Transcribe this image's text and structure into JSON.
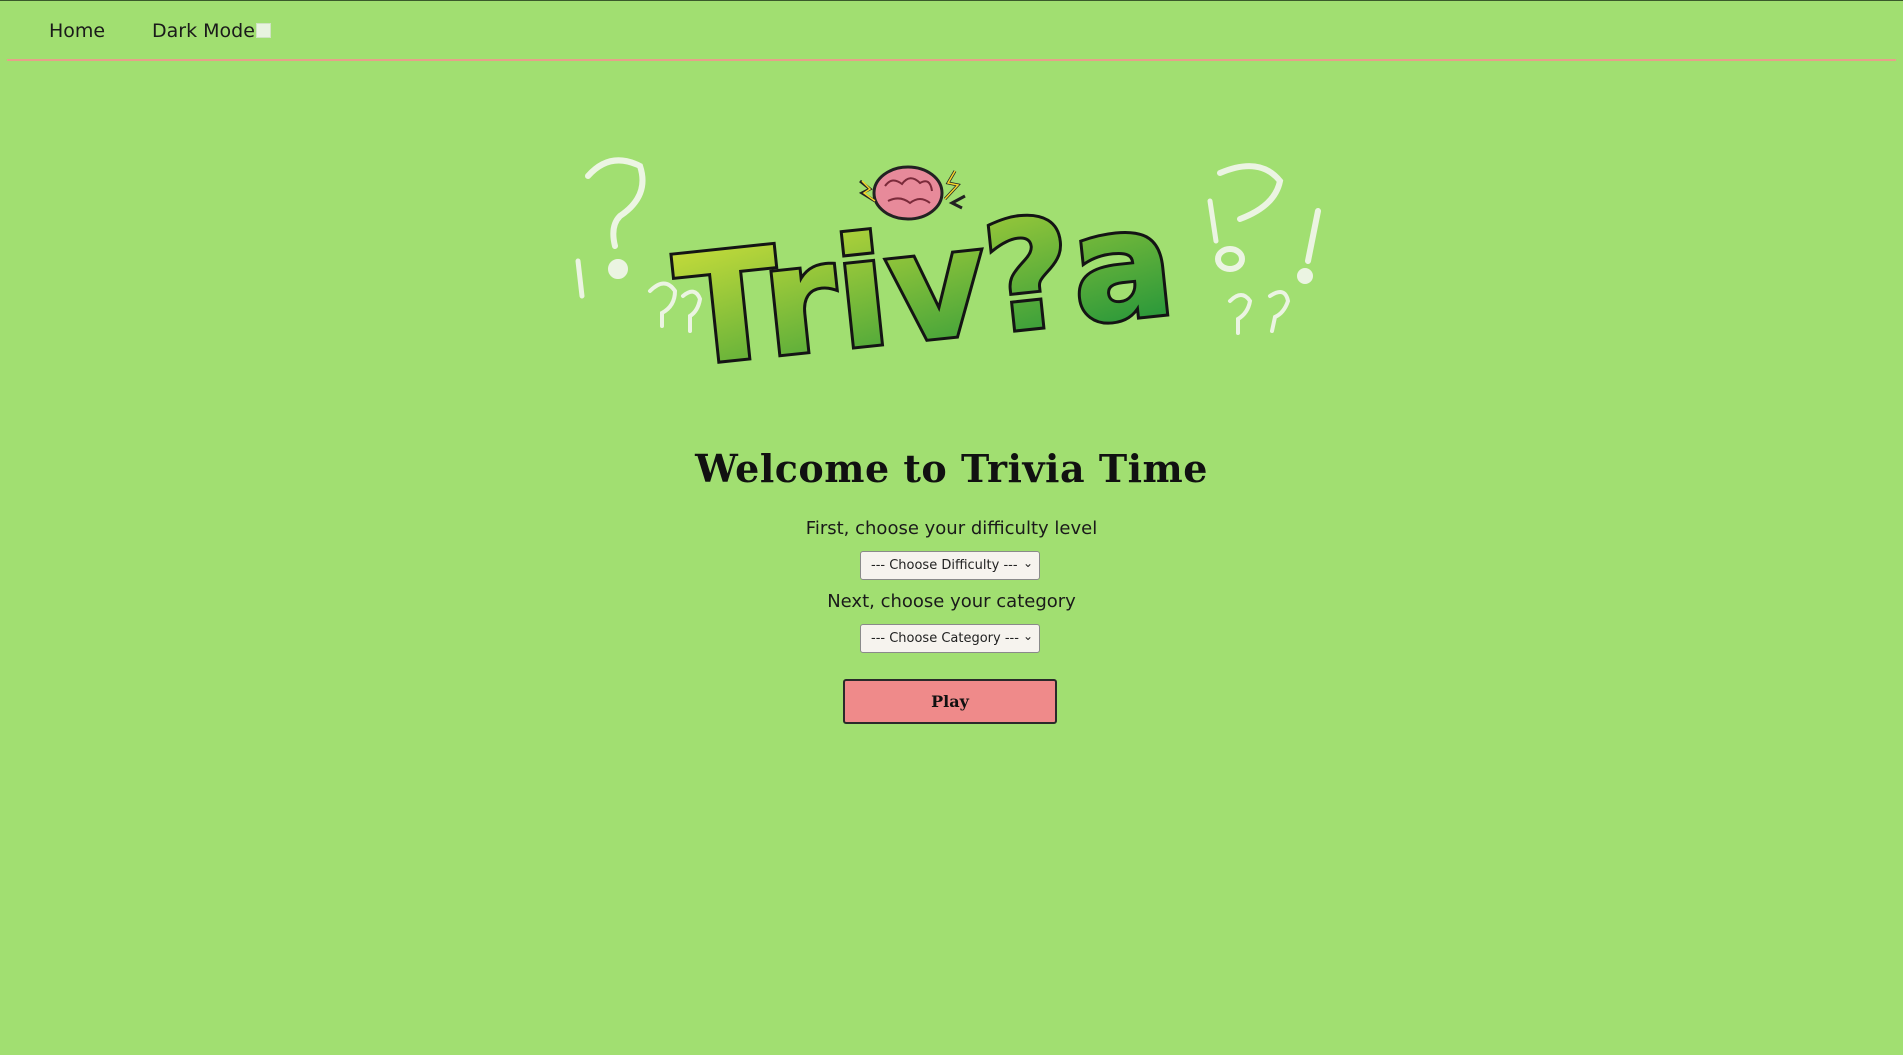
{
  "nav": {
    "home_label": "Home",
    "dark_mode_label": "Dark Mode"
  },
  "logo": {
    "text": "Triv?a",
    "icon": "brain-icon"
  },
  "main": {
    "title": "Welcome to Trivia Time",
    "difficulty_prompt": "First, choose your difficulty level",
    "difficulty_placeholder": "--- Choose Difficulty ---",
    "category_prompt": "Next, choose your category",
    "category_placeholder": "--- Choose Category ---",
    "play_label": "Play"
  },
  "colors": {
    "background": "#a1df71",
    "nav_border": "#e7a08a",
    "play_button": "#ef8a8a",
    "logo_green_light": "#d4e23a",
    "logo_green_dark": "#2e9a3a"
  }
}
